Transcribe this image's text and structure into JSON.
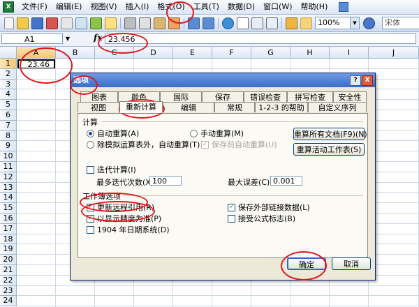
{
  "menubar": {
    "items": [
      "文件(F)",
      "编辑(E)",
      "视图(V)",
      "插入(I)",
      "格式(O)",
      "工具(T)",
      "数据(D)",
      "窗口(W)",
      "帮助(H)"
    ]
  },
  "toolbar": {
    "zoom": "100%",
    "font": "宋体"
  },
  "formula_bar": {
    "name_box": "A1",
    "fx": "fx",
    "formula": "23.456"
  },
  "grid": {
    "columns": [
      "A",
      "B",
      "C",
      "D",
      "E",
      "F",
      "G",
      "H",
      "I",
      "J"
    ],
    "rows": [
      "1",
      "2",
      "3",
      "4",
      "5",
      "6",
      "7",
      "8",
      "9",
      "10",
      "11",
      "12",
      "13",
      "14",
      "15",
      "16",
      "17",
      "18",
      "19",
      "20",
      "21",
      "22",
      "23",
      "24"
    ],
    "a1_value": "23.46"
  },
  "dialog": {
    "title": "选项",
    "help_btn": "?",
    "close_btn": "X",
    "tabs_back": [
      "图表",
      "颜色",
      "国际",
      "保存",
      "错误检查",
      "拼写检查",
      "安全性"
    ],
    "tabs_front": [
      "视图",
      "重新计算",
      "编辑",
      "常规",
      "1-2-3 的帮助",
      "自定义序列"
    ],
    "calc": {
      "label": "计算",
      "auto": "自动重算(A)",
      "manual": "手动重算(M)",
      "except_tables": "除模拟运算表外，自动重算(T)",
      "save_before": "保存前自动重算(U)",
      "recalc_all": "重算所有文档(F9)(N)",
      "recalc_sheet": "重算活动工作表(S)"
    },
    "iteration": {
      "label": "迭代计算(I)",
      "max_iter_label": "最多迭代次数(X):",
      "max_iter": "100",
      "max_change_label": "最大误差(C):",
      "max_change": "0.001"
    },
    "workbook": {
      "label": "工作簿选项",
      "update_refs": "更新远程引用(R)",
      "save_ext": "保存外部链接数据(L)",
      "precision": "以显示精度为准(P)",
      "accept_labels": "接受公式标志(B)",
      "date1904": "1904 年日期系统(D)"
    },
    "ok": "确定",
    "cancel": "取消"
  },
  "colors": {
    "annotation": "#e5141b",
    "dialog_bg": "#ece9d8",
    "title_bar": "#3a6cc9"
  }
}
